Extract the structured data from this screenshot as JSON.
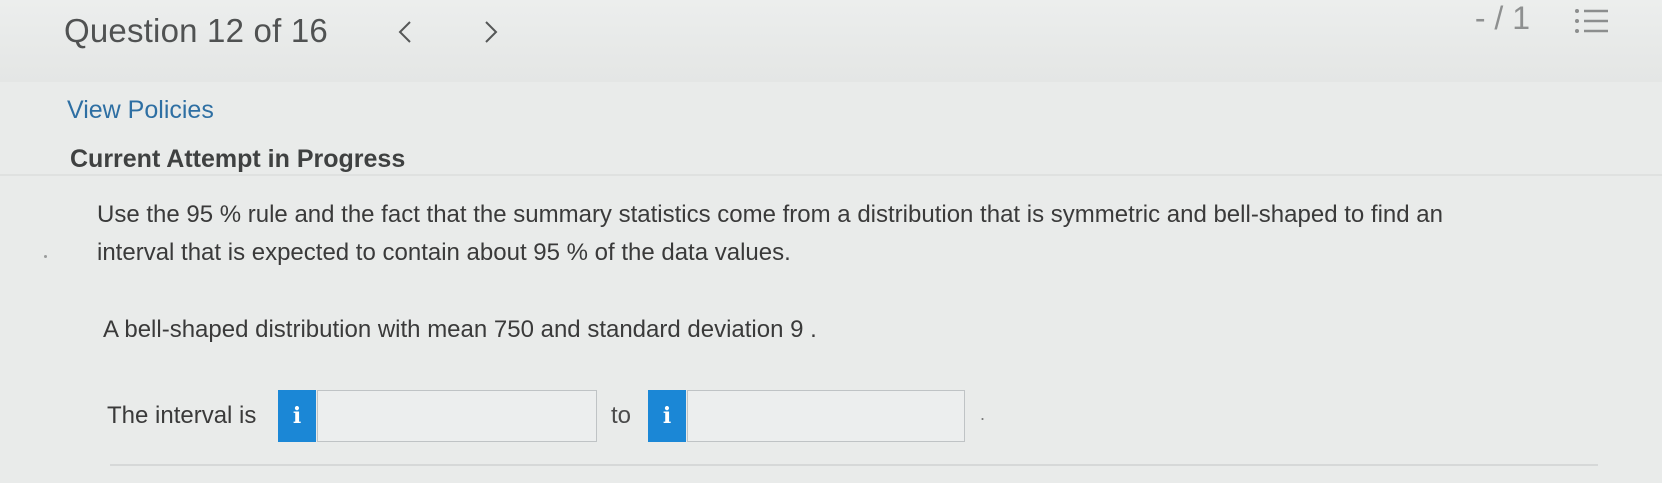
{
  "header": {
    "question_title": "Question 12 of 16",
    "prev_icon": "chevron-left-icon",
    "next_icon": "chevron-right-icon",
    "score": "- / 1",
    "menu_icon": "list-menu-icon"
  },
  "links": {
    "view_policies": "View Policies"
  },
  "attempt_status": "Current Attempt in Progress",
  "question": {
    "line1": "Use the 95 % rule and the fact that the summary statistics come from a distribution that is symmetric and bell-shaped to find an",
    "line2": "interval that is expected to contain about 95 % of the data values.",
    "distribution": "A bell-shaped distribution with mean 750 and standard deviation 9 ."
  },
  "answer": {
    "interval_label": "The interval is",
    "info_button_label": "i",
    "to_label": "to",
    "lower_value": "",
    "upper_value": "",
    "end_mark": "."
  },
  "colors": {
    "info_button": "#1b87d6",
    "link": "#2e6fa3",
    "background": "#e9ebea"
  }
}
